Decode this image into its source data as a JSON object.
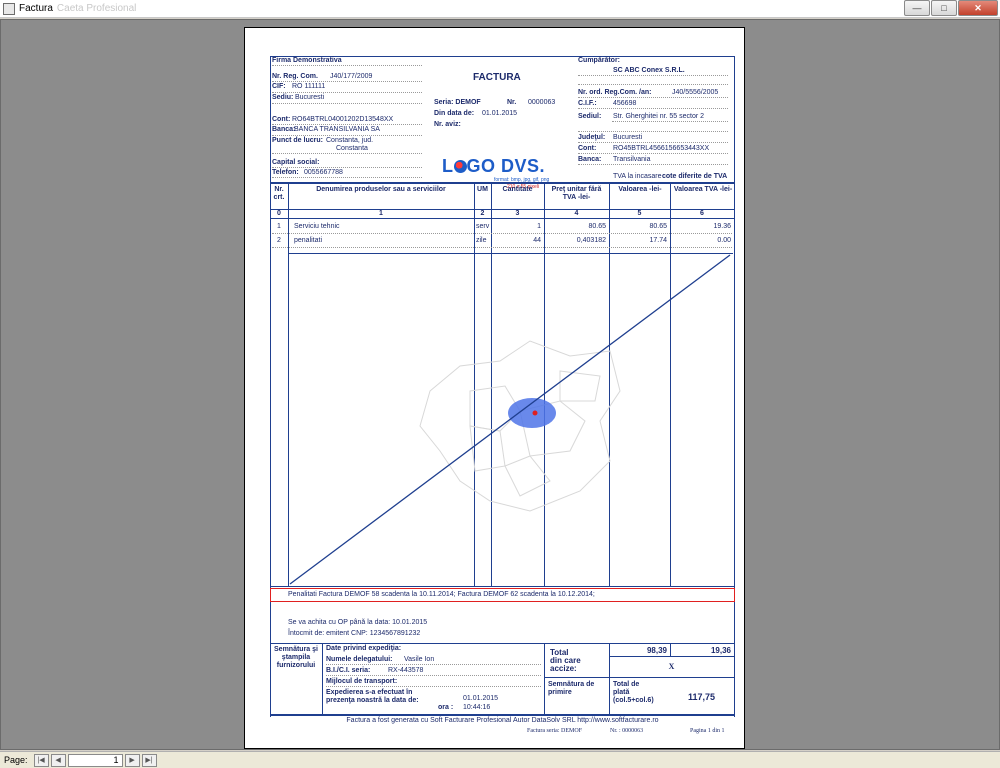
{
  "window": {
    "title": "Factura",
    "title_faded": "Caeta Profesional"
  },
  "winbtns": {
    "minimize": "—",
    "maximize": "□",
    "close": "✕"
  },
  "seller": {
    "name": "Firma Demonstrativa",
    "reg_label": "Nr. Reg. Com.",
    "reg": "J40/177/2009",
    "cif_label": "CIF:",
    "cif": "RO 111111",
    "sediu_label": "Sediu:",
    "sediu": "Bucuresti",
    "cont_label": "Cont:",
    "cont": "RO64BTRL04001202D13548XX",
    "banca_label": "Banca:",
    "banca": "BANCA TRANSILVANIA SA",
    "punct_label": "Punct de lucru:",
    "punct1": "Constanta, jud.",
    "punct2": "Constanta",
    "capital_label": "Capital social:",
    "telefon_label": "Telefon:",
    "telefon": "0055667788"
  },
  "invoice": {
    "title": "FACTURA",
    "seria_label": "Seria: DEMOF",
    "nr_label": "Nr.",
    "nr": "0000063",
    "data_label": "Din data de:",
    "data": "01.01.2015",
    "aviz_label": "Nr. aviz:"
  },
  "logo": {
    "text_pre": "L",
    "text_post": "GO DVS.",
    "formats": "format: bmp, jpg, gif, png",
    "size": "210 x 55 pixeli"
  },
  "buyer": {
    "heading": "Cumpărător:",
    "name": "SC ABC Conex S.R.L.",
    "reg_label": "Nr. ord. Reg.Com. /an:",
    "reg": "J40/5556/2005",
    "cif_label": "C.I.F.:",
    "cif": "456698",
    "sediu_label": "Sediul:",
    "sediu": "Str. Gherghitei nr. 55 sector 2",
    "judet_label": "Judeţul:",
    "judet": "Bucuresti",
    "cont_label": "Cont:",
    "cont": "RO45BTRL4566156653443XX",
    "banca_label": "Banca:",
    "banca": "Transilvania",
    "tva_note": "TVA la incasare",
    "tva_note2": "cote diferite de TVA"
  },
  "table": {
    "headers": [
      "Nr. crt.",
      "Denumirea produselor sau a serviciilor",
      "UM",
      "Cantitate",
      "Preţ unitar fără TVA -lei-",
      "Valoarea -lei-",
      "Valoarea TVA -lei-"
    ],
    "col_numbers": [
      "0",
      "1",
      "2",
      "3",
      "4",
      "5",
      "6"
    ],
    "rows": [
      {
        "nr": "1",
        "name": "Serviciu tehnic",
        "um": "serv",
        "qty": "1",
        "price": "80.65",
        "value": "80.65",
        "tva": "19.36"
      },
      {
        "nr": "2",
        "name": "penalitati",
        "um": "zile",
        "qty": "44",
        "price": "0,403182",
        "value": "17.74",
        "tva": "0.00"
      }
    ]
  },
  "penalty_note": "Penalitati Factura DEMOF 58 scadenta la 10.11.2014; Factura DEMOF 62 scadenta la 10.12.2014;",
  "payment": {
    "line1": "Se va achita cu OP până la data: 10.01.2015",
    "line2": "Întocmit de: emitent  CNP: 1234567891232"
  },
  "footer": {
    "stamp_label": "Semnătura şi ştampila furnizorului",
    "exp_title": "Date privind expediţia:",
    "delegat_label": "Numele delegatului:",
    "delegat": "Vasile Ion",
    "bi_label": "B.I./C.I. seria:",
    "bi": "RX-443578",
    "transport_label": "Mijlocul de transport:",
    "exp_label1": "Expedierea s-a efectuat în",
    "exp_label2": "prezenţa noastră la data de:",
    "exp_date": "01.01.2015",
    "ora_label": "ora :",
    "ora": "10:44:16",
    "total_label1": "Total",
    "total_label2": "din care",
    "total_label3": "accize:",
    "total_value": "98,39",
    "total_tva": "19,36",
    "x_mark": "X",
    "sig_label1": "Semnătura de",
    "sig_label2": "primire",
    "plata_label1": "Total de",
    "plata_label2": "plată",
    "plata_label3": "(col.5+col.6)",
    "plata_value": "117,75",
    "generated": "Factura a fost generata cu Soft Facturare Profesional Autor DataSolv SRL http://www.softfacturare.ro",
    "seria_footer": "Factura seria:  DEMOF",
    "nr_footer": "Nr. :  0000063",
    "pagina": "Pagina 1 din 1"
  },
  "bottombar": {
    "page_label": "Page:",
    "page_value": "1",
    "first": "|◀",
    "prev": "◀",
    "next": "▶",
    "last": "▶|"
  }
}
